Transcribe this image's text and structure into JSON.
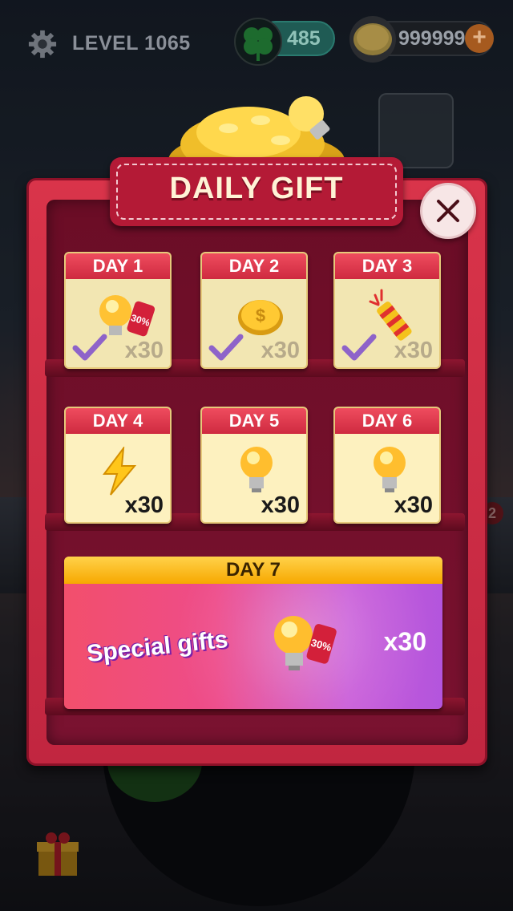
{
  "hud": {
    "level_label": "LEVEL 1065",
    "clovers": "485",
    "coins": "999999",
    "plus_label": "+"
  },
  "background": {
    "badge": "2"
  },
  "dialog": {
    "title": "DAILY GIFT",
    "close_icon": "close-icon",
    "days": [
      {
        "label": "DAY 1",
        "item": "bulb-discount-icon",
        "count": "x30",
        "claimed": true,
        "tag": "30%"
      },
      {
        "label": "DAY 2",
        "item": "coin-icon",
        "count": "x30",
        "claimed": true
      },
      {
        "label": "DAY 3",
        "item": "firework-icon",
        "count": "x30",
        "claimed": true
      },
      {
        "label": "DAY 4",
        "item": "lightning-icon",
        "count": "x30",
        "claimed": false
      },
      {
        "label": "DAY 5",
        "item": "bulb-icon",
        "count": "x30",
        "claimed": false
      },
      {
        "label": "DAY 6",
        "item": "bulb-icon",
        "count": "x30",
        "claimed": false
      }
    ],
    "day7": {
      "label": "DAY 7",
      "special": "Special gifts",
      "count": "x30",
      "tag": "30%"
    }
  },
  "colors": {
    "dialog": "#c9283f",
    "card_header": "#e03a4e",
    "card_body": "#fdf1bf",
    "day7_header": "#fbbd1d",
    "check": "#8e63c9"
  }
}
